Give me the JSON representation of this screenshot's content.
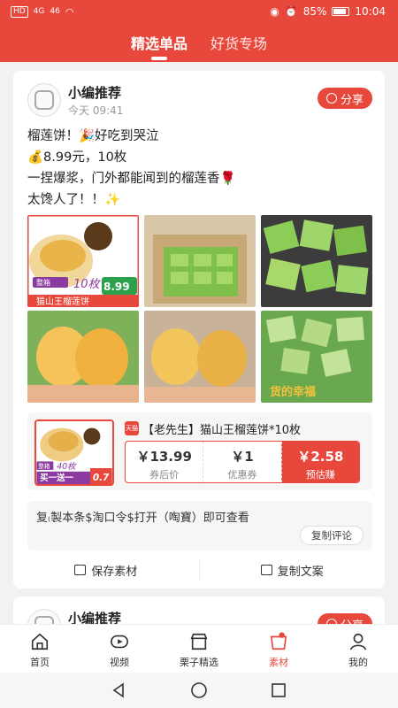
{
  "status_bar": {
    "left_icons": [
      "HD",
      "4G",
      "46",
      "wifi"
    ],
    "battery_percent": "85%",
    "time": "10:04"
  },
  "tabs": [
    {
      "label": "精选单品",
      "active": true
    },
    {
      "label": "好货专场",
      "active": false
    }
  ],
  "post": {
    "author": "小编推荐",
    "time": "今天 09:41",
    "share_label": "分享",
    "lines": [
      "榴莲饼！🎉好吃到哭泣",
      "💰8.99元，10枚",
      "一捏爆浆，门外都能闻到的榴莲香🌹",
      "太馋人了！！✨"
    ],
    "image_overlays": {
      "tag_left": "整箱",
      "count": "10枚",
      "price": "8.99",
      "price_tag": "券后价",
      "brand_banner": "猫山王榴莲饼",
      "happiness": "货的幸福"
    },
    "product": {
      "store_badge": "天猫",
      "title": "【老先生】猫山王榴莲饼*10枚",
      "thumb_overlay_tag": "整箱",
      "thumb_overlay_count": "40枚",
      "thumb_overlay_bogo": "买一送一",
      "thumb_overlay_price": "0.7",
      "after_coupon_price": "￥13.99",
      "after_coupon_label": "券后价",
      "coupon_value": "￥1",
      "coupon_label": "优惠券",
      "earn_value": "￥2.58",
      "earn_label": "预估赚"
    },
    "copy_text": "复₍製本条$淘口令$打开（啕寶）即可查看",
    "copy_comment_label": "复制评论",
    "save_material_label": "保存素材",
    "copy_text_label": "复制文案"
  },
  "next_post": {
    "author": "小编推荐",
    "share_label": "分享"
  },
  "bottom_nav": [
    {
      "label": "首页",
      "icon": "home-icon",
      "active": false
    },
    {
      "label": "视频",
      "icon": "video-icon",
      "active": false
    },
    {
      "label": "栗子精选",
      "icon": "store-icon",
      "active": false
    },
    {
      "label": "素材",
      "icon": "material-icon",
      "active": true
    },
    {
      "label": "我的",
      "icon": "user-icon",
      "active": false
    }
  ],
  "colors": {
    "brand": "#e8473c",
    "background": "#f2f2f2"
  }
}
